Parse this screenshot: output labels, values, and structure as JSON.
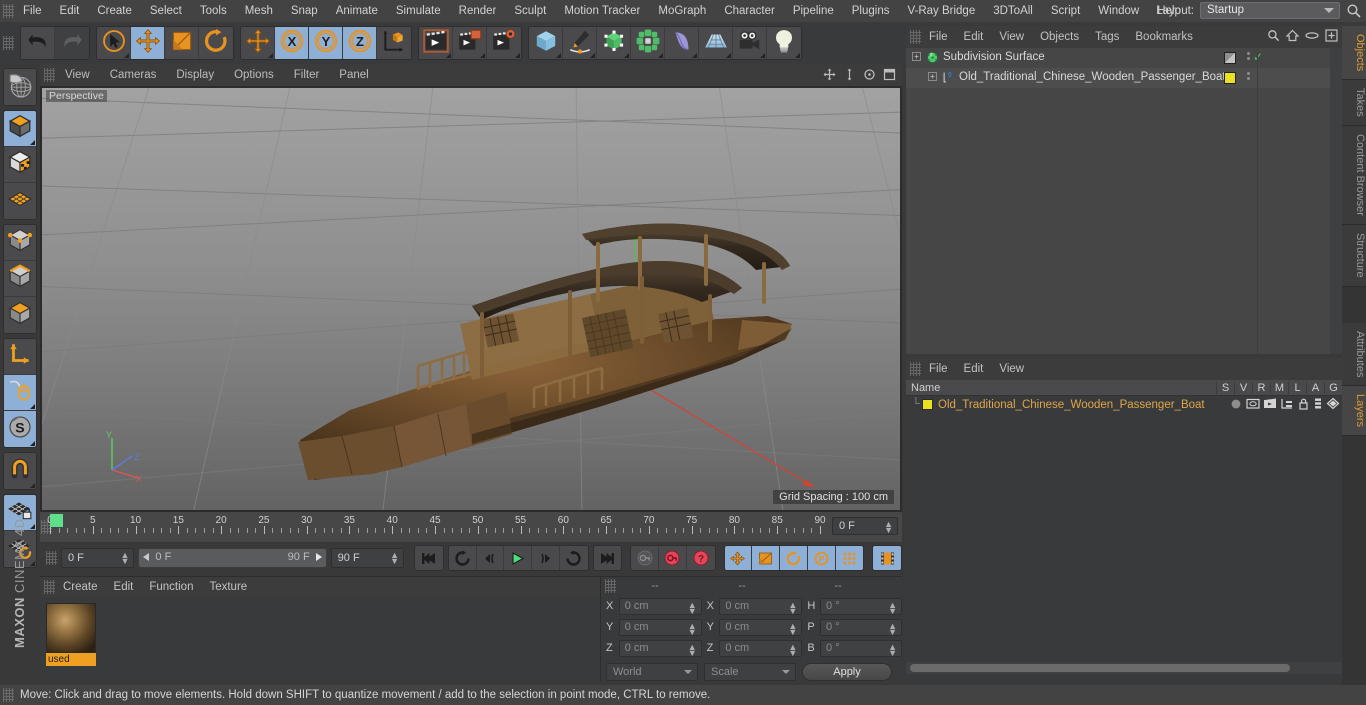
{
  "app": {
    "brand": "MAXON",
    "product": "CINEMA 4D"
  },
  "menubar": {
    "items": [
      "File",
      "Edit",
      "Create",
      "Select",
      "Tools",
      "Mesh",
      "Snap",
      "Animate",
      "Simulate",
      "Render",
      "Sculpt",
      "Motion Tracker",
      "MoGraph",
      "Character",
      "Pipeline",
      "Plugins",
      "V-Ray Bridge",
      "3DToAll",
      "Script",
      "Window",
      "Help"
    ],
    "layout_label": "Layout:",
    "layout_value": "Startup",
    "search_icon": "search-icon",
    "home_icon": "home-icon",
    "eye_icon": "eye-icon",
    "plus_icon": "plus-icon"
  },
  "toolbar": {
    "groups": [
      {
        "buttons": [
          {
            "name": "undo-button",
            "icon": "undo-arrow-icon",
            "state": "normal"
          },
          {
            "name": "redo-button",
            "icon": "redo-arrow-icon",
            "state": "disabled"
          }
        ]
      },
      {
        "buttons": [
          {
            "name": "live-selection-button",
            "icon": "cursor-circle-icon",
            "state": "normal"
          },
          {
            "name": "move-tool-button",
            "icon": "move-cross-icon",
            "state": "active"
          },
          {
            "name": "scale-tool-button",
            "icon": "scale-box-icon",
            "state": "normal"
          },
          {
            "name": "rotate-tool-button",
            "icon": "rotate-arc-icon",
            "state": "normal"
          }
        ]
      },
      {
        "buttons": [
          {
            "name": "move-axis-button",
            "icon": "move-cross-icon",
            "state": "normal"
          },
          {
            "name": "lock-x-axis-button",
            "icon": "axis-x-icon",
            "label": "X",
            "state": "active"
          },
          {
            "name": "lock-y-axis-button",
            "icon": "axis-y-icon",
            "label": "Y",
            "state": "active"
          },
          {
            "name": "lock-z-axis-button",
            "icon": "axis-z-icon",
            "label": "Z",
            "state": "active"
          },
          {
            "name": "world-object-coord-button",
            "icon": "world-axis-cube-icon",
            "state": "normal"
          }
        ]
      },
      {
        "buttons": [
          {
            "name": "render-view-button",
            "icon": "clapper-icon",
            "state": "normal"
          },
          {
            "name": "render-to-picture-viewer-button",
            "icon": "clapper-picture-icon",
            "state": "normal"
          },
          {
            "name": "render-settings-button",
            "icon": "clapper-gear-icon",
            "state": "normal"
          }
        ]
      },
      {
        "buttons": [
          {
            "name": "add-cube-button",
            "icon": "cube-icon",
            "state": "normal"
          },
          {
            "name": "add-spline-button",
            "icon": "pen-spline-icon",
            "state": "normal"
          },
          {
            "name": "nurbs-generator-button",
            "icon": "green-cube-icon",
            "state": "normal"
          },
          {
            "name": "array-modeling-button",
            "icon": "green-cluster-icon",
            "state": "normal"
          },
          {
            "name": "deformer-button",
            "icon": "bend-deformer-icon",
            "state": "normal"
          },
          {
            "name": "environment-button",
            "icon": "floor-grid-icon",
            "state": "normal"
          },
          {
            "name": "camera-button",
            "icon": "camera-icon",
            "state": "normal"
          },
          {
            "name": "light-button",
            "icon": "light-bulb-icon",
            "state": "normal"
          }
        ]
      }
    ]
  },
  "left_toolbar": {
    "groups": [
      {
        "buttons": [
          {
            "name": "undo-view-button",
            "icon": "globe-grid-icon",
            "state": "normal"
          }
        ]
      },
      {
        "buttons": [
          {
            "name": "object-mode-button",
            "icon": "object-cube-icon",
            "state": "active"
          },
          {
            "name": "texture-mode-button",
            "icon": "texture-cube-icon",
            "state": "normal"
          },
          {
            "name": "workplane-mode-button",
            "icon": "workplane-grid-icon",
            "state": "normal"
          }
        ]
      },
      {
        "buttons": [
          {
            "name": "point-mode-button",
            "icon": "point-cube-icon",
            "state": "normal"
          },
          {
            "name": "edge-mode-button",
            "icon": "edge-cube-icon",
            "state": "normal"
          },
          {
            "name": "polygon-mode-button",
            "icon": "polygon-cube-icon",
            "state": "normal"
          }
        ]
      },
      {
        "buttons": [
          {
            "name": "axis-mode-button",
            "icon": "axis-l-icon",
            "state": "normal"
          },
          {
            "name": "viewport-solo-button",
            "icon": "mouse-icon",
            "state": "active"
          },
          {
            "name": "snap-button",
            "icon": "snap-s-icon",
            "state": "active"
          }
        ]
      },
      {
        "buttons": [
          {
            "name": "magnet-button",
            "icon": "magnet-icon",
            "state": "normal"
          }
        ]
      },
      {
        "buttons": [
          {
            "name": "lock-workplane-button",
            "icon": "workplane-lock-icon",
            "state": "active"
          },
          {
            "name": "workplane-rotate-button",
            "icon": "workplane-rotate-icon",
            "state": "normal"
          }
        ]
      }
    ]
  },
  "viewport": {
    "menu": [
      "View",
      "Cameras",
      "Display",
      "Options",
      "Filter",
      "Panel"
    ],
    "label": "Perspective",
    "grid_spacing": "Grid Spacing : 100 cm",
    "axis_labels": {
      "y": "Y",
      "z": "Z",
      "x": "X"
    },
    "nav_icons": [
      "pan-icon",
      "zoom-icon",
      "rotate-icon",
      "maximize-icon"
    ]
  },
  "timeline": {
    "ticks": [
      0,
      5,
      10,
      15,
      20,
      25,
      30,
      35,
      40,
      45,
      50,
      55,
      60,
      65,
      70,
      75,
      80,
      85,
      90
    ],
    "current_frame_field": "0 F",
    "playhead_frame": 0
  },
  "transport": {
    "current_frame": "0 F",
    "range_start": "0 F",
    "range_end": "90 F",
    "end_frame": "90 F",
    "buttons": [
      {
        "name": "go-to-start-button",
        "icon": "skip-start-icon"
      },
      {
        "name": "go-to-previous-key-button",
        "icon": "prev-key-icon"
      },
      {
        "name": "step-back-button",
        "icon": "step-back-icon"
      },
      {
        "name": "play-button",
        "icon": "play-icon"
      },
      {
        "name": "step-forward-button",
        "icon": "step-forward-icon"
      },
      {
        "name": "go-to-next-key-button",
        "icon": "next-key-icon"
      },
      {
        "name": "go-to-end-button",
        "icon": "skip-end-icon"
      },
      {
        "name": "record-key-button",
        "icon": "key-icon"
      },
      {
        "name": "autokey-button",
        "icon": "autokey-circle-icon"
      },
      {
        "name": "keyframe-selection-button",
        "icon": "question-circle-icon"
      },
      {
        "name": "position-key-button",
        "icon": "move-cross-icon"
      },
      {
        "name": "scale-key-button",
        "icon": "scale-box-icon"
      },
      {
        "name": "rotation-key-button",
        "icon": "rotate-arc-icon"
      },
      {
        "name": "pla-key-button",
        "icon": "p-circle-icon"
      },
      {
        "name": "point-level-animation-button",
        "icon": "dot-grid-icon"
      },
      {
        "name": "timeline-toggle-button",
        "icon": "filmstrip-icon"
      }
    ]
  },
  "material_manager": {
    "menu": [
      "Create",
      "Edit",
      "Function",
      "Texture"
    ],
    "materials": [
      {
        "name": "used"
      }
    ]
  },
  "coordinates": {
    "header": [
      "--",
      "--",
      "--"
    ],
    "rows": [
      {
        "pos_label": "X",
        "pos_value": "0 cm",
        "size_label": "X",
        "size_value": "0 cm",
        "rot_label": "H",
        "rot_value": "0 °"
      },
      {
        "pos_label": "Y",
        "pos_value": "0 cm",
        "size_label": "Y",
        "size_value": "0 cm",
        "rot_label": "P",
        "rot_value": "0 °"
      },
      {
        "pos_label": "Z",
        "pos_value": "0 cm",
        "size_label": "Z",
        "size_value": "0 cm",
        "rot_label": "B",
        "rot_value": "0 °"
      }
    ],
    "space_select": "World",
    "mode_select": "Scale",
    "apply_label": "Apply"
  },
  "object_manager": {
    "menu": [
      "File",
      "Edit",
      "View",
      "Objects",
      "Tags",
      "Bookmarks"
    ],
    "rows": [
      {
        "name": "Subdivision Surface",
        "icon": "subdivision-surface-icon",
        "indent": 0,
        "visible_check": "✓",
        "tag_color": null
      },
      {
        "name": "Old_Traditional_Chinese_Wooden_Passenger_Boat",
        "icon": "polygon-object-icon",
        "indent": 1,
        "visible_check": null,
        "tag_color": "#e9e01f"
      }
    ]
  },
  "layer_manager": {
    "menu": [
      "File",
      "Edit",
      "View"
    ],
    "columns": [
      "Name",
      "S",
      "V",
      "R",
      "M",
      "L",
      "A",
      "G"
    ],
    "rows": [
      {
        "name": "Old_Traditional_Chinese_Wooden_Passenger_Boat",
        "color": "#e9e01f"
      }
    ]
  },
  "right_tabs_top": [
    "Objects",
    "Takes",
    "Content Browser",
    "Structure"
  ],
  "right_tabs_bottom": [
    "Attributes",
    "Layers"
  ],
  "status_bar": {
    "message": "Move: Click and drag to move elements. Hold down SHIFT to quantize movement / add to the selection in point mode, CTRL to remove."
  },
  "colors": {
    "accent_orange": "#e8921f",
    "selection_blue": "#8fb0d6",
    "panel_bg": "#393a3b",
    "menu_bg": "#434344",
    "text": "#c9c9c9",
    "tag_yellow": "#e9e01f",
    "play_green": "#5ee08a"
  }
}
